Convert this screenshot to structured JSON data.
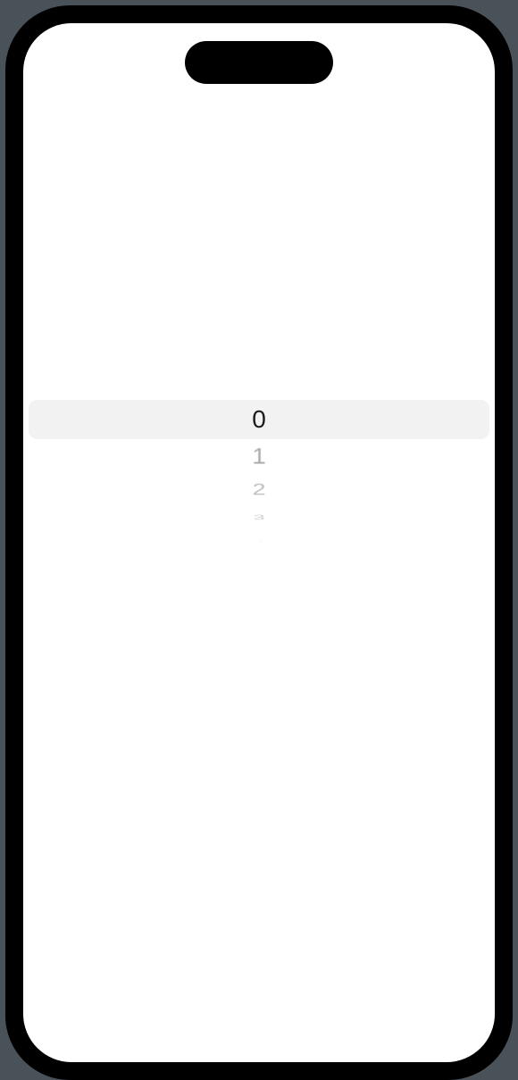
{
  "picker": {
    "selected_index": 0,
    "items": [
      {
        "label": "0"
      },
      {
        "label": "1"
      },
      {
        "label": "2"
      },
      {
        "label": "3"
      },
      {
        "label": "4"
      }
    ]
  }
}
